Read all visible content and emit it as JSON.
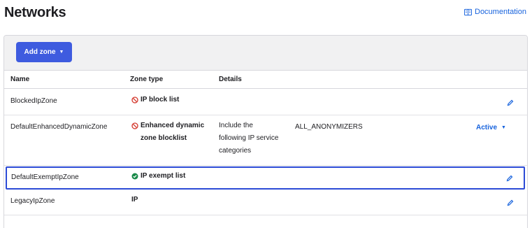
{
  "header": {
    "title": "Networks",
    "doc_link": "Documentation"
  },
  "toolbar": {
    "add_zone_label": "Add zone",
    "add_zone_caret": "▼"
  },
  "table": {
    "columns": [
      "Name",
      "Zone type",
      "Details"
    ],
    "rows": [
      {
        "name": "BlockedIpZone",
        "zone_type": "IP block list",
        "zone_icon": "block-icon",
        "details": "",
        "details_value": "",
        "status": ""
      },
      {
        "name": "DefaultEnhancedDynamicZone",
        "zone_type_line1": "Enhanced dynamic",
        "zone_type_line2": "zone blocklist",
        "zone_icon": "block-icon",
        "details_line1": "Include the",
        "details_line2": "following IP service",
        "details_line3": "categories",
        "details_value": "ALL_ANONYMIZERS",
        "status": "Active",
        "status_caret": "▼"
      },
      {
        "name": "DefaultExemptIpZone",
        "zone_type": "IP exempt list",
        "zone_icon": "check-circle-icon",
        "details": "",
        "status": ""
      },
      {
        "name": "LegacyIpZone",
        "zone_type": "IP",
        "zone_icon": "",
        "details": "",
        "status": ""
      }
    ]
  },
  "colors": {
    "accent": "#3e5bdf",
    "link": "#1662dd",
    "block_red": "#d4372c",
    "success_green": "#1a8a4a",
    "selected_border": "#2c4bd6"
  }
}
